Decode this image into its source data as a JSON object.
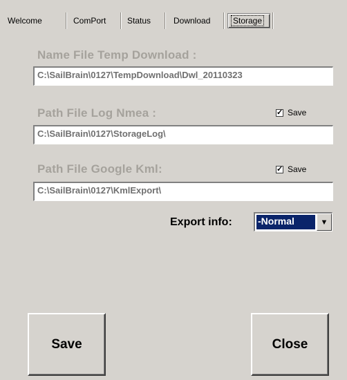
{
  "tabs": [
    {
      "label": "Welcome"
    },
    {
      "label": "ComPort"
    },
    {
      "label": "Status"
    },
    {
      "label": "Download"
    },
    {
      "label": "Storage",
      "active": true
    }
  ],
  "fields": {
    "temp_download": {
      "label": "Name File Temp Download :",
      "value": "C:\\SailBrain\\0127\\TempDownload\\Dwl_20110323"
    },
    "log_nmea": {
      "label": "Path File Log Nmea :",
      "value": "C:\\SailBrain\\0127\\StorageLog\\",
      "save_label": "Save",
      "save_checked": true
    },
    "google_kml": {
      "label": "Path File Google Kml:",
      "value": "C:\\SailBrain\\0127\\KmlExport\\",
      "save_label": "Save",
      "save_checked": true
    }
  },
  "export_info": {
    "label": "Export info:",
    "selected": "-Normal"
  },
  "buttons": {
    "save": "Save",
    "close": "Close"
  },
  "colors": {
    "background": "#d6d3ce",
    "disabled_label": "#a5a29c",
    "selection": "#0a246a"
  }
}
